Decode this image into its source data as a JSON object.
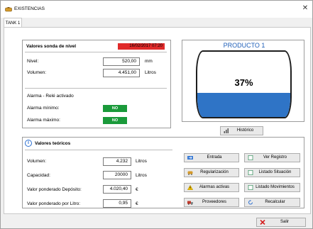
{
  "window": {
    "title": "EXISTENCIAS"
  },
  "tabs": [
    {
      "label": "TANK 1"
    }
  ],
  "sonda": {
    "title": "Valores sonda de nivel",
    "date": "16/02/2017 07:20",
    "nivel_label": "Nivel:",
    "nivel_value": "520,00",
    "nivel_unit": "mm",
    "volumen_label": "Volumen:",
    "volumen_value": "4.451,00",
    "volumen_unit": "Litros",
    "alarm_title": "Alarma - Relé activado",
    "alarma_min_label": "Alarma mínimo:",
    "alarma_min_status": "NO",
    "alarma_max_label": "Alarma máximo:",
    "alarma_max_status": "NO"
  },
  "product": {
    "title": "PRODUCTO 1",
    "percent_text": "37%",
    "fill_fraction": 0.37,
    "fill_color": "#2f74c6",
    "historico_label": "Histórico"
  },
  "teoricos": {
    "title": "Valores teóricos",
    "volumen_label": "Volumen:",
    "volumen_value": "4.232",
    "volumen_unit": "Litros",
    "capacidad_label": "Capacidad:",
    "capacidad_value": "20000",
    "capacidad_unit": "Litros",
    "vpd_label": "Valor ponderado Depósito:",
    "vpd_value": "4.020,40",
    "vpd_unit": "€",
    "vpl_label": "Valor ponderado por Litro:",
    "vpl_value": "0,95",
    "vpl_unit": "€"
  },
  "actions": {
    "entrada": "Entrada",
    "regularizacion": "Regularización",
    "alarmas": "Alarmas activas",
    "proveedores": "Proveedores",
    "ver_registro": "Ver Registro",
    "listado_situacion": "Listado Situación",
    "listado_movimientos": "Listado Movimientos",
    "recalcular": "Recalcular"
  },
  "footer": {
    "salir": "Salir"
  },
  "colors": {
    "alarm_date": "#e02a2a",
    "status_ok": "#1a9a3a",
    "accent": "#1f5fb8"
  }
}
